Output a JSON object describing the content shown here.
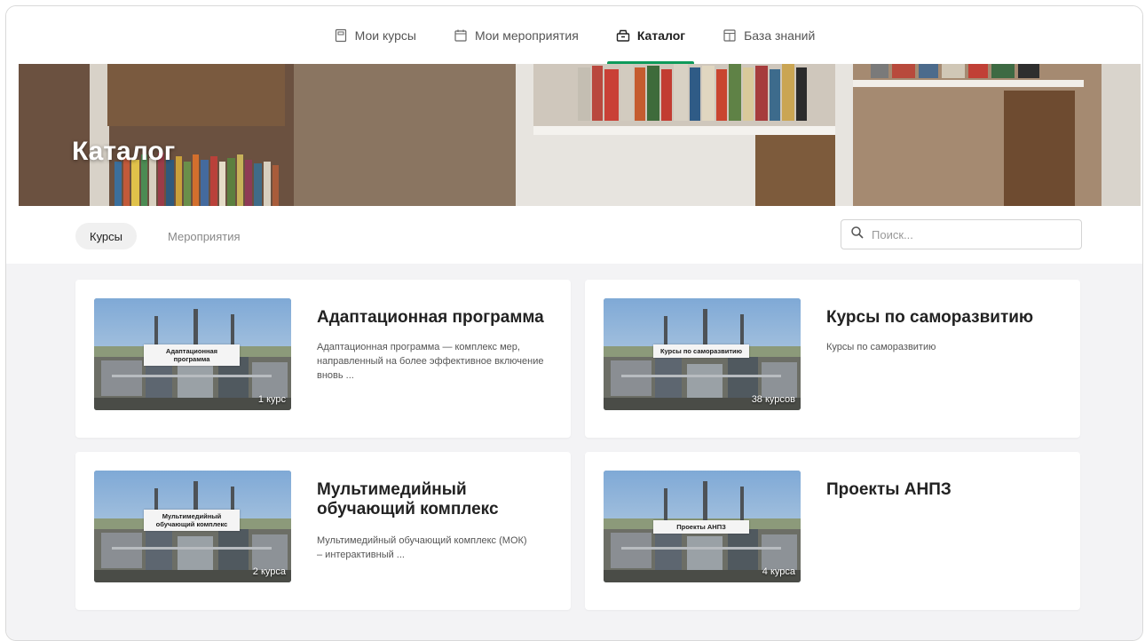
{
  "nav": {
    "items": [
      {
        "label": "Мои курсы",
        "icon": "course-icon",
        "active": false
      },
      {
        "label": "Мои мероприятия",
        "icon": "calendar-icon",
        "active": false
      },
      {
        "label": "Каталог",
        "icon": "catalog-icon",
        "active": true
      },
      {
        "label": "База знаний",
        "icon": "knowledge-base-icon",
        "active": false
      }
    ]
  },
  "hero": {
    "title": "Каталог"
  },
  "filters": {
    "tabs": [
      {
        "label": "Курсы",
        "active": true
      },
      {
        "label": "Мероприятия",
        "active": false
      }
    ],
    "search_placeholder": "Поиск..."
  },
  "cards": [
    {
      "title": "Адаптационная программа",
      "description": "Адаптационная программа — комплекс мер, направленный на более эффективное включение вновь ...",
      "thumb_label": "Адаптационная программа",
      "count": "1 курс"
    },
    {
      "title": "Курсы по саморазвитию",
      "description": "Курсы по саморазвитию",
      "thumb_label": "Курсы по саморазвитию",
      "count": "38 курсов"
    },
    {
      "title": "Мультимедийный обучающий комплекс",
      "description": "Мультимедийный обучающий комплекс (МОК) – интерактивный ...",
      "thumb_label": "Мультимедийный обучающий комплекс",
      "count": "2 курса"
    },
    {
      "title": "Проекты АНПЗ",
      "description": "",
      "thumb_label": "Проекты АНПЗ",
      "count": "4 курса"
    }
  ],
  "colors": {
    "accent": "#0e9a5b",
    "catalog_bg": "#f3f3f5"
  }
}
